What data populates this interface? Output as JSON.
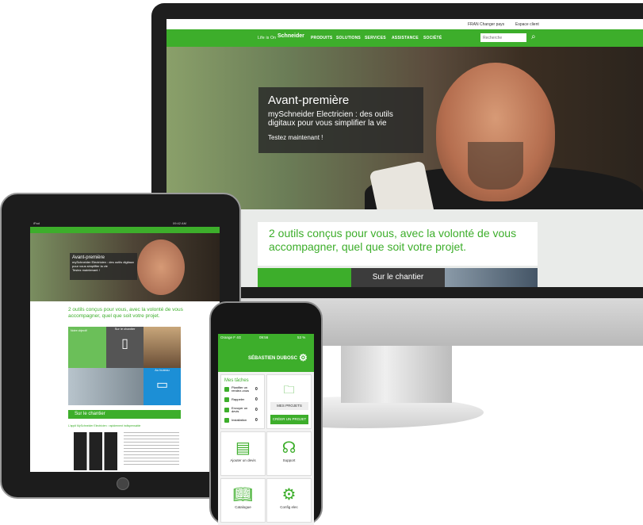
{
  "monitor": {
    "topbar": {
      "country": "FRAN Changer pays",
      "account": "Espace client"
    },
    "nav": {
      "life_label": "Life is On",
      "logo": "Schneider",
      "items": [
        "PRODUITS",
        "SOLUTIONS",
        "SERVICES",
        "ASSISTANCE",
        "SOCIÉTÉ"
      ],
      "search_placeholder": "Recherche"
    },
    "hero": {
      "title": "Avant-première",
      "subtitle": "mySchneider Electricien : des outils digitaux pour vous simplifier la vie",
      "cta": "Testez maintenant !"
    },
    "intro": "2 outils conçus pour vous, avec la volonté de vous accompagner, quel que soit votre projet.",
    "tile_label": "Sur le chantier"
  },
  "tablet": {
    "status_left": "iPad",
    "status_right": "09:42 AM",
    "hero": {
      "title": "Avant-première",
      "subtitle": "mySchneider Electricien : des outils digitaux pour vous simplifier la vie",
      "cta": "Testez maintenant !"
    },
    "intro": "2 outils conçus pour vous, avec la volonté de vous accompagner, quel que soit votre projet.",
    "tile_chantier": "Sur le chantier",
    "tile_bureau": "Au bureau",
    "section_bar": "Sur le chantier",
    "app_title": "L'appli MySchneider Electricien : rapidement indispensable",
    "green_tile_title": "Notre objectif"
  },
  "phone": {
    "status": {
      "carrier": "Orange F 4G",
      "time": "09:56",
      "battery": "53 %"
    },
    "header_name": "SÉBASTIEN DUBOSC",
    "tasks": {
      "heading": "Mes tâches",
      "items": [
        {
          "label": "Planifier un rendez-vous",
          "count": "0"
        },
        {
          "label": "Rappeler",
          "count": "0"
        },
        {
          "label": "Envoyer un devis",
          "count": "0"
        },
        {
          "label": "Installation",
          "count": "0"
        }
      ]
    },
    "projects": {
      "mes_projets": "MES PROJETS",
      "creer": "CRÉER UN PROJET"
    },
    "tiles": [
      "Ajouter un devis",
      "Support",
      "Catalogue",
      "Config elec"
    ]
  }
}
